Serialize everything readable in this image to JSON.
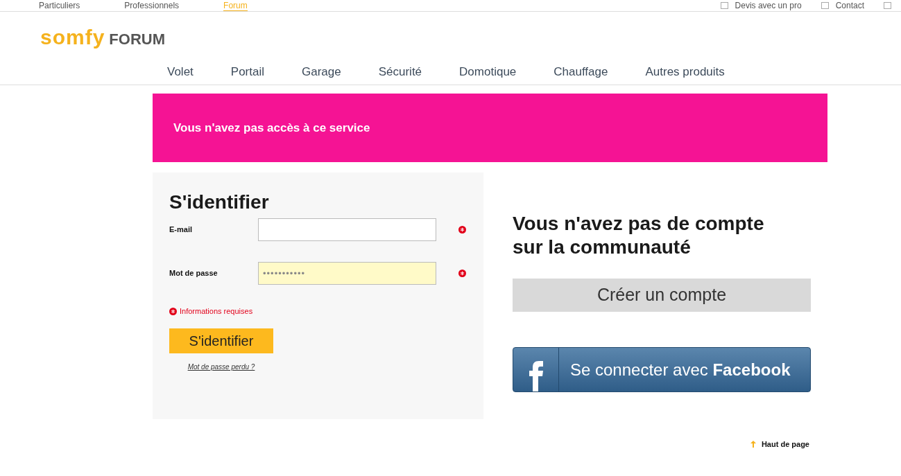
{
  "top_nav": {
    "items": [
      {
        "label": "Particuliers",
        "selected": false
      },
      {
        "label": "Professionnels",
        "selected": false
      },
      {
        "label": "Forum",
        "selected": true
      }
    ],
    "links": [
      "Devis avec un pro",
      "Contact"
    ]
  },
  "logo": {
    "brand": "somfy",
    "suffix": "FORUM"
  },
  "category_nav": [
    "Volet",
    "Portail",
    "Garage",
    "Sécurité",
    "Domotique",
    "Chauffage",
    "Autres produits"
  ],
  "alert": "Vous n'avez pas accès à ce service",
  "login": {
    "title": "S'identifier",
    "fields": [
      {
        "label": "E-mail",
        "highlighted": false,
        "required": true
      },
      {
        "label": "Mot de passe",
        "value": "•••••••••••",
        "highlighted": true,
        "required": true
      }
    ],
    "required_note": "Informations requises",
    "submit": "S'identifier",
    "forgot": "Mot de passe perdu ?"
  },
  "signup": {
    "title": "Vous n'avez pas de compte sur la communauté",
    "create": "Créer un compte",
    "facebook": "Se connecter avec **Facebook**"
  },
  "back_to_top": "Haut de page"
}
